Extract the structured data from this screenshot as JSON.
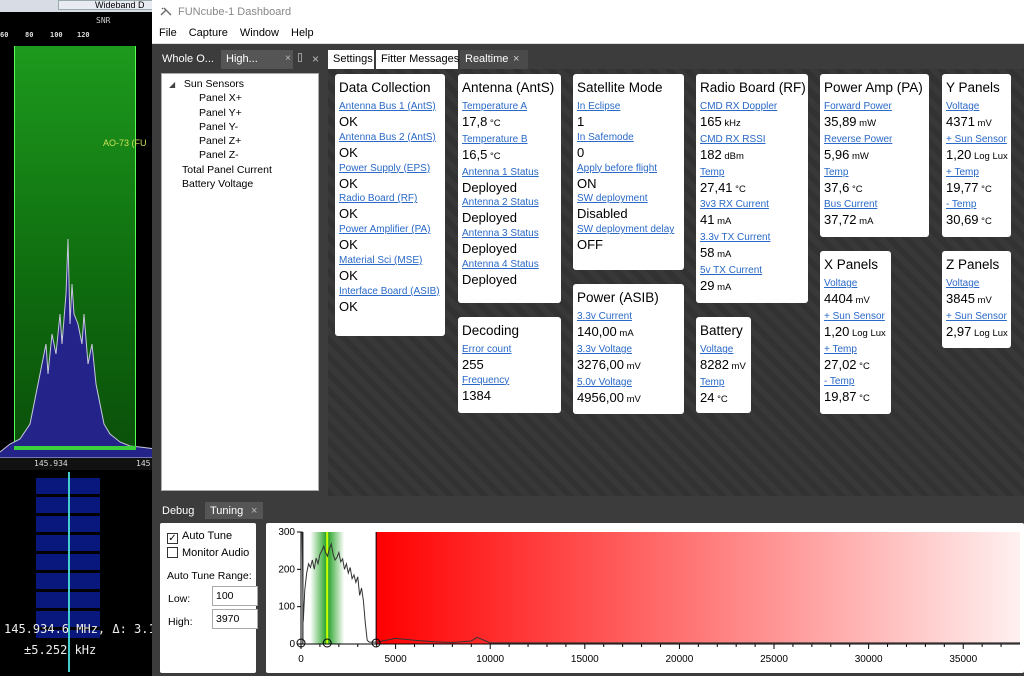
{
  "left_app": {
    "top_button": "Wideband D",
    "snr_label": "SNR",
    "scale_ticks": [
      "60",
      "80",
      "100",
      "120"
    ],
    "marker": "AO-73 (FU",
    "freq_axis": [
      "145.934",
      "145."
    ],
    "readout": "145.934.6 MHz, Δ: 3.1",
    "offset": "±5.252 kHz"
  },
  "window": {
    "title": "FUNcube-1 Dashboard",
    "menu": [
      "File",
      "Capture",
      "Window",
      "Help"
    ]
  },
  "left_panel": {
    "tabs": [
      "Whole O...",
      "High..."
    ],
    "tree": [
      {
        "label": "Sun Sensors",
        "level": 0,
        "expander": true
      },
      {
        "label": "Panel X+",
        "level": 2
      },
      {
        "label": "Panel Y+",
        "level": 2
      },
      {
        "label": "Panel Y-",
        "level": 2
      },
      {
        "label": "Panel Z+",
        "level": 2
      },
      {
        "label": "Panel Z-",
        "level": 2
      },
      {
        "label": "Total Panel Current",
        "level": 1
      },
      {
        "label": "Battery Voltage",
        "level": 1
      }
    ]
  },
  "right_panel": {
    "tabs": [
      "Settings",
      "Fitter Messages",
      "Realtime"
    ]
  },
  "cards": [
    {
      "title": "Data Collection",
      "rows": [
        {
          "k": "Antenna Bus 1 (AntS)",
          "v": "OK"
        },
        {
          "k": "Antenna Bus 2 (AntS)",
          "v": "OK"
        },
        {
          "k": "Power Supply (EPS)",
          "v": "OK"
        },
        {
          "k": "Radio Board (RF)",
          "v": "OK"
        },
        {
          "k": "Power Amplifier (PA)",
          "v": "OK"
        },
        {
          "k": "Material Sci (MSE)",
          "v": "OK"
        },
        {
          "k": "Interface Board (ASIB)",
          "v": "OK"
        }
      ]
    },
    {
      "title": "Antenna (AntS)",
      "rows": [
        {
          "k": "Temperature A",
          "v": "17,8",
          "u": "°C"
        },
        {
          "k": "Temperature B",
          "v": "16,5",
          "u": "°C"
        },
        {
          "k": "Antenna 1 Status",
          "v": "Deployed"
        },
        {
          "k": "Antenna 2 Status",
          "v": "Deployed"
        },
        {
          "k": "Antenna 3 Status",
          "v": "Deployed"
        },
        {
          "k": "Antenna 4 Status",
          "v": "Deployed"
        }
      ]
    },
    {
      "title": "Decoding",
      "rows": [
        {
          "k": "Error count",
          "v": "255"
        },
        {
          "k": "Frequency",
          "v": "1384"
        }
      ]
    },
    {
      "title": "Satellite Mode",
      "rows": [
        {
          "k": "In Eclipse",
          "v": "1"
        },
        {
          "k": "In Safemode",
          "v": "0"
        },
        {
          "k": "Apply before flight",
          "v": "ON"
        },
        {
          "k": "SW deployment",
          "v": "Disabled"
        },
        {
          "k": "SW deployment delay",
          "v": "OFF"
        }
      ]
    },
    {
      "title": "Power (ASIB)",
      "rows": [
        {
          "k": "3.3v Current",
          "v": "140,00",
          "u": "mA"
        },
        {
          "k": "3.3v Voltage",
          "v": "3276,00",
          "u": "mV"
        },
        {
          "k": "5.0v Voltage",
          "v": "4956,00",
          "u": "mV"
        }
      ]
    },
    {
      "title": "Radio Board (RF)",
      "rows": [
        {
          "k": "CMD RX Doppler",
          "v": "165",
          "u": "kHz"
        },
        {
          "k": "CMD RX RSSI",
          "v": "182",
          "u": "dBm"
        },
        {
          "k": "Temp",
          "v": "27,41",
          "u": "°C"
        },
        {
          "k": "3v3 RX Current",
          "v": "41",
          "u": "mA"
        },
        {
          "k": "3.3v TX Current",
          "v": "58",
          "u": "mA"
        },
        {
          "k": "5v TX Current",
          "v": "29",
          "u": "mA"
        }
      ]
    },
    {
      "title": "Battery",
      "rows": [
        {
          "k": "Voltage",
          "v": "8282",
          "u": "mV"
        },
        {
          "k": "Temp",
          "v": "24",
          "u": "°C"
        }
      ]
    },
    {
      "title": "Power Amp (PA)",
      "rows": [
        {
          "k": "Forward Power",
          "v": "35,89",
          "u": "mW"
        },
        {
          "k": "Reverse Power",
          "v": "5,96",
          "u": "mW"
        },
        {
          "k": "Temp",
          "v": "37,6",
          "u": "°C"
        },
        {
          "k": "Bus Current",
          "v": "37,72",
          "u": "mA"
        }
      ]
    },
    {
      "title": "X Panels",
      "rows": [
        {
          "k": "Voltage",
          "v": "4404",
          "u": "mV"
        },
        {
          "k": "+ Sun Sensor",
          "v": "1,20",
          "u": "Log Lux"
        },
        {
          "k": "+ Temp",
          "v": "27,02",
          "u": "°C"
        },
        {
          "k": "- Temp",
          "v": "19,87",
          "u": "°C"
        }
      ]
    },
    {
      "title": "Y Panels",
      "rows": [
        {
          "k": "Voltage",
          "v": "4371",
          "u": "mV"
        },
        {
          "k": "+ Sun Sensor",
          "v": "1,20",
          "u": "Log Lux"
        },
        {
          "k": "+ Temp",
          "v": "19,77",
          "u": "°C"
        },
        {
          "k": "- Temp",
          "v": "30,69",
          "u": "°C"
        }
      ]
    },
    {
      "title": "Z Panels",
      "rows": [
        {
          "k": "Voltage",
          "v": "3845",
          "u": "mV"
        },
        {
          "k": "+ Sun Sensor",
          "v": "2,97",
          "u": "Log Lux"
        }
      ]
    }
  ],
  "bottom_panel": {
    "tabs": [
      "Debug",
      "Tuning"
    ],
    "auto_tune": "Auto Tune",
    "auto_tune_checked": true,
    "monitor_audio": "Monitor Audio",
    "monitor_audio_checked": false,
    "range_label": "Auto Tune Range:",
    "low_label": "Low:",
    "low_value": "100",
    "high_label": "High:",
    "high_value": "3970"
  },
  "chart_data": {
    "type": "line",
    "xlim": [
      0,
      38000
    ],
    "ylim": [
      0,
      300
    ],
    "x_ticks": [
      0,
      5000,
      10000,
      15000,
      20000,
      25000,
      30000,
      35000
    ],
    "y_ticks": [
      0,
      100,
      200,
      300
    ],
    "tuning_range": [
      100,
      3970
    ],
    "tuned_frequency": 1384,
    "marker_x": [
      0,
      1384,
      3970
    ],
    "series": [
      {
        "x": [
          0,
          60,
          120,
          200,
          300,
          400,
          500,
          600,
          700,
          800,
          900,
          1000,
          1100,
          1200,
          1300,
          1400,
          1500,
          1600,
          1700,
          1800,
          1900,
          2000,
          2100,
          2200,
          2300,
          2400,
          2500,
          2600,
          2700,
          2800,
          2900,
          3000,
          3100,
          3200,
          3300,
          3400,
          3500,
          3600,
          3700,
          3800,
          3900,
          4000,
          5000,
          6000,
          7000,
          8000,
          9000,
          9300,
          10000,
          15000,
          20000,
          25000,
          30000,
          35000,
          38000
        ],
        "y": [
          300,
          300,
          60,
          145,
          190,
          215,
          205,
          225,
          200,
          230,
          215,
          240,
          250,
          262,
          245,
          235,
          255,
          268,
          240,
          225,
          232,
          245,
          220,
          228,
          200,
          215,
          190,
          205,
          175,
          185,
          165,
          180,
          130,
          150,
          115,
          55,
          10,
          5,
          5,
          5,
          5,
          5,
          15,
          10,
          6,
          4,
          8,
          18,
          3,
          3,
          3,
          3,
          3,
          3,
          3
        ]
      }
    ]
  }
}
